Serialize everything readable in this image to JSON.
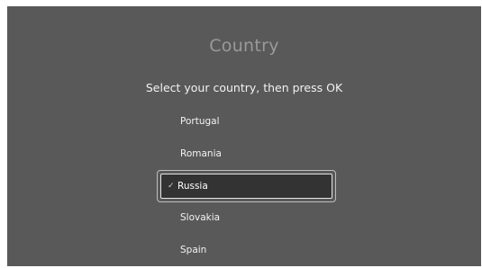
{
  "screen": {
    "title": "Country",
    "instruction": "Select your country, then press OK"
  },
  "countries": {
    "items": [
      {
        "label": "Portugal",
        "selected": false
      },
      {
        "label": "Romania",
        "selected": false
      },
      {
        "label": "Russia",
        "selected": true
      },
      {
        "label": "Slovakia",
        "selected": false
      },
      {
        "label": "Spain",
        "selected": false
      }
    ],
    "check_glyph": "✓"
  },
  "colors": {
    "background": "#595959",
    "title": "#9a9a9a",
    "focus_fill": "#333333",
    "focus_border": "#e6e6e6"
  }
}
